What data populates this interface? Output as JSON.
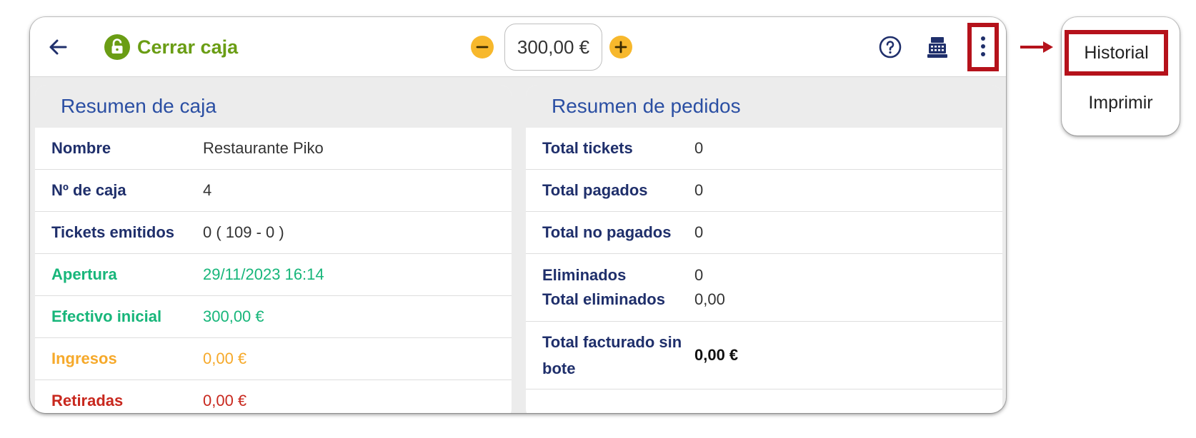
{
  "header": {
    "title": "Cerrar caja",
    "amount": "300,00 €",
    "icons": {
      "back": "arrow-left-icon",
      "lock": "lock-icon",
      "minus": "minus-circle-icon",
      "plus": "plus-circle-icon",
      "help": "help-circle-icon",
      "register": "cash-register-icon",
      "more": "more-vertical-icon"
    }
  },
  "summary_box": {
    "title": "Resumen de caja",
    "rows": [
      {
        "label": "Nombre",
        "value": "Restaurante Piko"
      },
      {
        "label": "Nº de caja",
        "value": "4"
      },
      {
        "label": "Tickets emitidos",
        "value": "0 ( 109 - 0 )"
      },
      {
        "label": "Apertura",
        "value": "29/11/2023 16:14"
      },
      {
        "label": "Efectivo inicial",
        "value": "300,00 €"
      },
      {
        "label": "Ingresos",
        "value": "0,00 €"
      },
      {
        "label": "Retiradas",
        "value": "0,00 €"
      }
    ]
  },
  "orders_box": {
    "title": "Resumen de pedidos",
    "rows": [
      {
        "label": "Total tickets",
        "value": "0"
      },
      {
        "label": "Total pagados",
        "value": "0"
      },
      {
        "label": "Total no pagados",
        "value": "0"
      },
      {
        "label": "Eliminados",
        "value": "0"
      },
      {
        "label": "Total eliminados",
        "value": "0,00"
      },
      {
        "label": "Total facturado sin bote",
        "value": "0,00 €"
      }
    ]
  },
  "menu": {
    "items": [
      "Historial",
      "Imprimir"
    ]
  },
  "colors": {
    "accent_green": "#6a9d14",
    "title_blue": "#2b4fa3",
    "label_navy": "#1f2f6b",
    "positive_green": "#17b67a",
    "income_orange": "#f6a92a",
    "withdraw_red": "#c8281e",
    "highlight_red": "#b5121b",
    "button_yellow": "#f7b82c"
  }
}
